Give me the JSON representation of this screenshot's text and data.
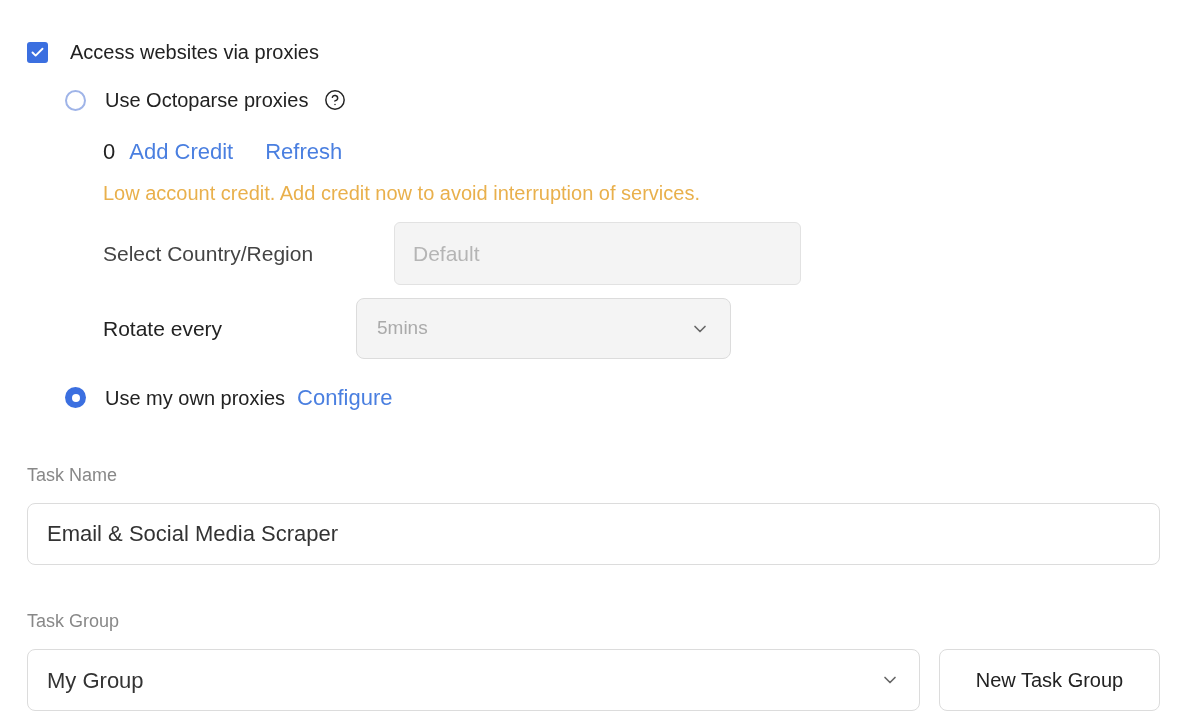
{
  "proxy": {
    "label": "Access websites via proxies",
    "checked": true
  },
  "options": [
    {
      "kind": "octoparse",
      "label": "Use Octoparse proxies",
      "selected": false
    },
    {
      "kind": "own",
      "label": "Use my own proxies",
      "selected": true,
      "link": "Configure"
    }
  ],
  "credit": {
    "balance": "0",
    "add_link": "Add Credit",
    "refresh_link": "Refresh",
    "warning": "Low account credit. Add credit now to avoid interruption of services."
  },
  "country": {
    "label": "Select Country/Region",
    "placeholder": "Default",
    "disabled": true
  },
  "rotate": {
    "label": "Rotate every",
    "value": "5mins",
    "disabled": true
  },
  "task_name": {
    "label": "Task Name",
    "value": "Email & Social Media Scraper"
  },
  "task_group": {
    "label": "Task Group",
    "value": "My Group",
    "button": "New Task Group"
  }
}
